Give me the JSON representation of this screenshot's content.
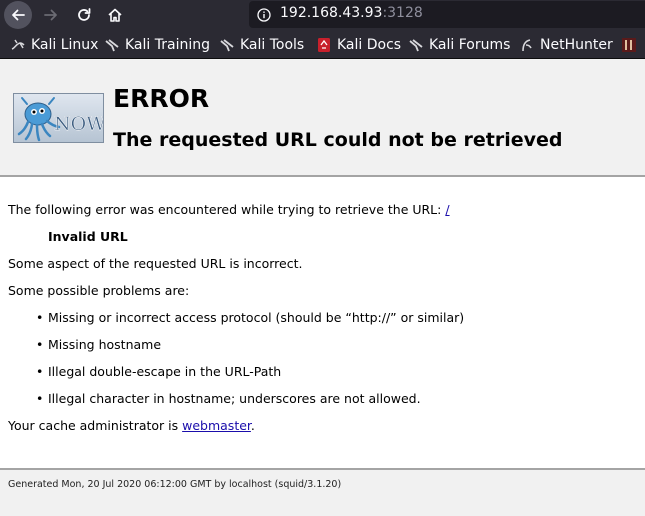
{
  "browser": {
    "url_host": "192.168.43.93",
    "url_port": ":3128"
  },
  "bookmarks": [
    {
      "label": "Kali Linux",
      "icon": "kali-dragon-icon"
    },
    {
      "label": "Kali Training",
      "icon": "kali-dragon-icon"
    },
    {
      "label": "Kali Tools",
      "icon": "kali-dragon-icon"
    },
    {
      "label": "Kali Docs",
      "icon": "exploit-db-icon"
    },
    {
      "label": "Kali Forums",
      "icon": "kali-dragon-icon"
    },
    {
      "label": "NetHunter",
      "icon": "nethunter-icon"
    }
  ],
  "error": {
    "title": "ERROR",
    "subtitle": "The requested URL could not be retrieved",
    "logo_text": "NOW"
  },
  "content": {
    "intro": "The following error was encountered while trying to retrieve the URL: ",
    "url_link": "/",
    "error_name": "Invalid URL",
    "description": "Some aspect of the requested URL is incorrect.",
    "problems_intro": "Some possible problems are:",
    "problems": [
      "Missing or incorrect access protocol (should be “http://” or similar)",
      "Missing hostname",
      "Illegal double-escape in the URL-Path",
      "Illegal character in hostname; underscores are not allowed."
    ],
    "admin_prefix": "Your cache administrator is ",
    "admin_link": "webmaster",
    "admin_suffix": "."
  },
  "footer": {
    "generated": "Generated Mon, 20 Jul 2020 06:12:00 GMT by localhost (squid/3.1.20)"
  },
  "colors": {
    "chrome": "#2b2a33",
    "urlbar": "#1c1b22",
    "header_bg": "#f1f1f1",
    "link": "#1a0dab"
  }
}
